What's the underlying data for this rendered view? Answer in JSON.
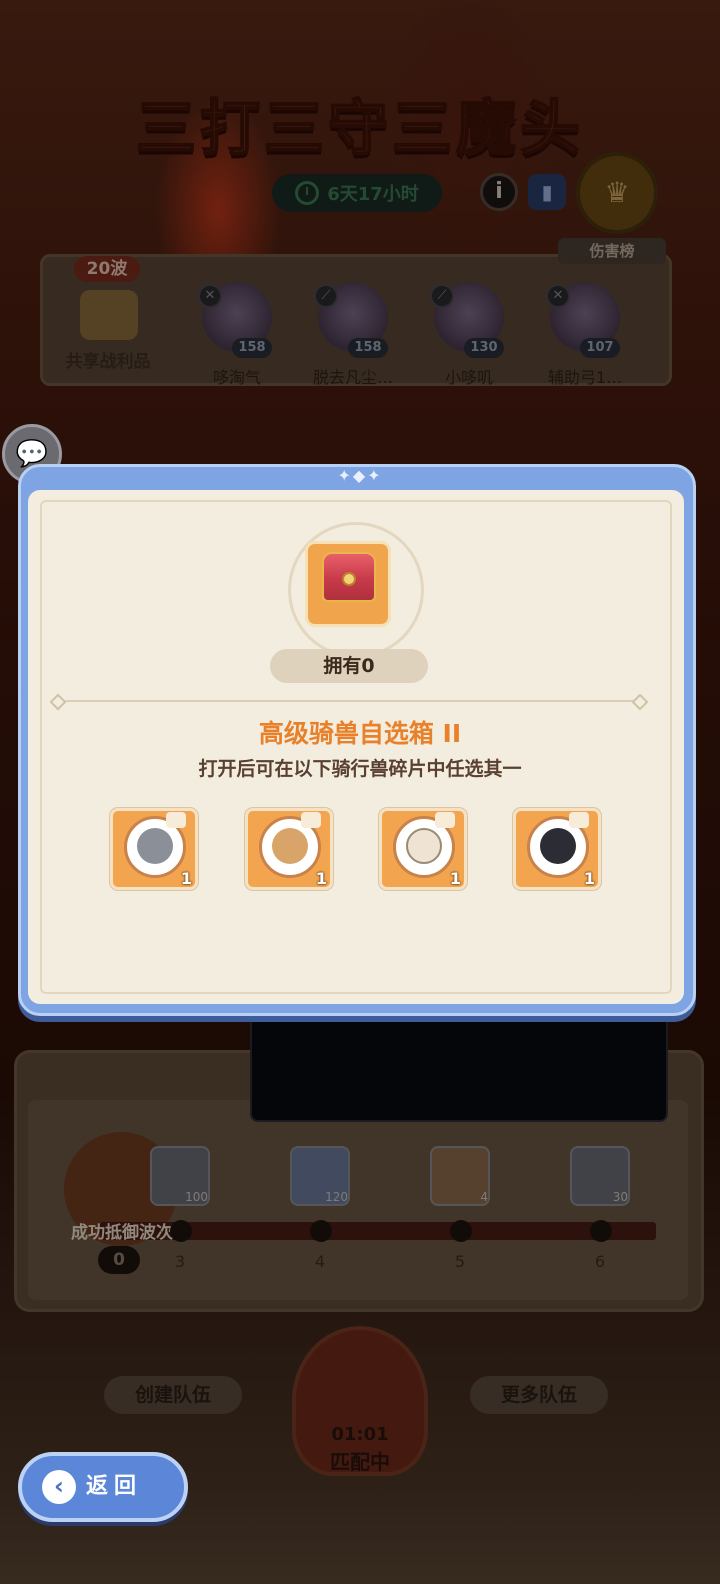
{
  "event": {
    "title": "三打三守三魔头",
    "timer": "6天17小时",
    "info_icon": "info-icon",
    "book_icon": "book-icon",
    "rank_icon": "ranking-icon"
  },
  "team": {
    "wave": "20波",
    "loot_label": "共享战利品",
    "damage_rank": "伤害榜",
    "members": [
      {
        "name": "哆淘气",
        "level": "158"
      },
      {
        "name": "脱去凡尘…",
        "level": "158"
      },
      {
        "name": "小哆叽",
        "level": "130"
      },
      {
        "name": "辅助弓1…",
        "level": "107"
      }
    ]
  },
  "rewards": {
    "defense_label": "成功抵御波次",
    "current": "0",
    "milestones": [
      {
        "num": "3",
        "count": "100"
      },
      {
        "num": "4",
        "count": "120"
      },
      {
        "num": "5",
        "count": "4"
      },
      {
        "num": "6",
        "count": "30"
      }
    ]
  },
  "buttons": {
    "create_team": "创建队伍",
    "more_teams": "更多队伍",
    "match_time": "01:01",
    "match_state": "匹配中",
    "back": "返回"
  },
  "modal": {
    "owned": "拥有0",
    "item_name": "高级骑兽自选箱 II",
    "description": "打开后可在以下骑行兽碎片中任选其一",
    "choices": [
      {
        "count": "1",
        "color": "#8a8f98"
      },
      {
        "count": "1",
        "color": "#d8a46a"
      },
      {
        "count": "1",
        "color": "#efe4d4"
      },
      {
        "count": "1",
        "color": "#2c2c34"
      }
    ]
  },
  "colors": {
    "accent_orange": "#e8812a",
    "modal_blue": "#7ea4e4",
    "tile_orange": "#f2a44e"
  }
}
